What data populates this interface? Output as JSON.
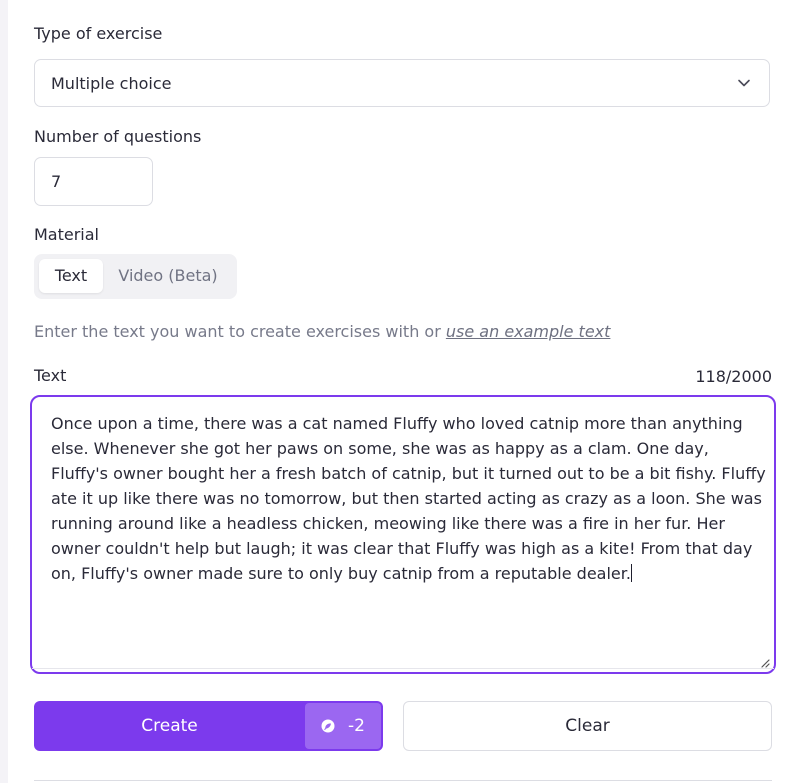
{
  "exercise_type": {
    "label": "Type of exercise",
    "value": "Multiple choice",
    "icon": "chevron-down-icon"
  },
  "questions": {
    "label": "Number of questions",
    "value": "7"
  },
  "material": {
    "label": "Material",
    "options": [
      "Text",
      "Video (Beta)"
    ],
    "selected": "Text"
  },
  "hint": {
    "text": "Enter the text you want to create exercises with or ",
    "link": "use an example text"
  },
  "text_field": {
    "label": "Text",
    "counter": "118/2000",
    "value": "Once upon a time, there was a cat named Fluffy who loved catnip more than anything else. Whenever she got her paws on some, she was as happy as a clam. One day, Fluffy's owner bought her a fresh batch of catnip, but it turned out to be a bit fishy. Fluffy ate it up like there was no tomorrow, but then started acting as crazy as a loon. She was running around like a headless chicken, meowing like there was a fire in her fur. Her owner couldn't help but laugh; it was clear that Fluffy was high as a kite! From that day on, Fluffy's owner made sure to only buy catnip from a reputable dealer."
  },
  "actions": {
    "create_label": "Create",
    "cost": "-2",
    "cost_icon": "credit-icon",
    "clear_label": "Clear"
  },
  "colors": {
    "accent": "#7c3aed",
    "accent_light": "#9b67f1"
  }
}
